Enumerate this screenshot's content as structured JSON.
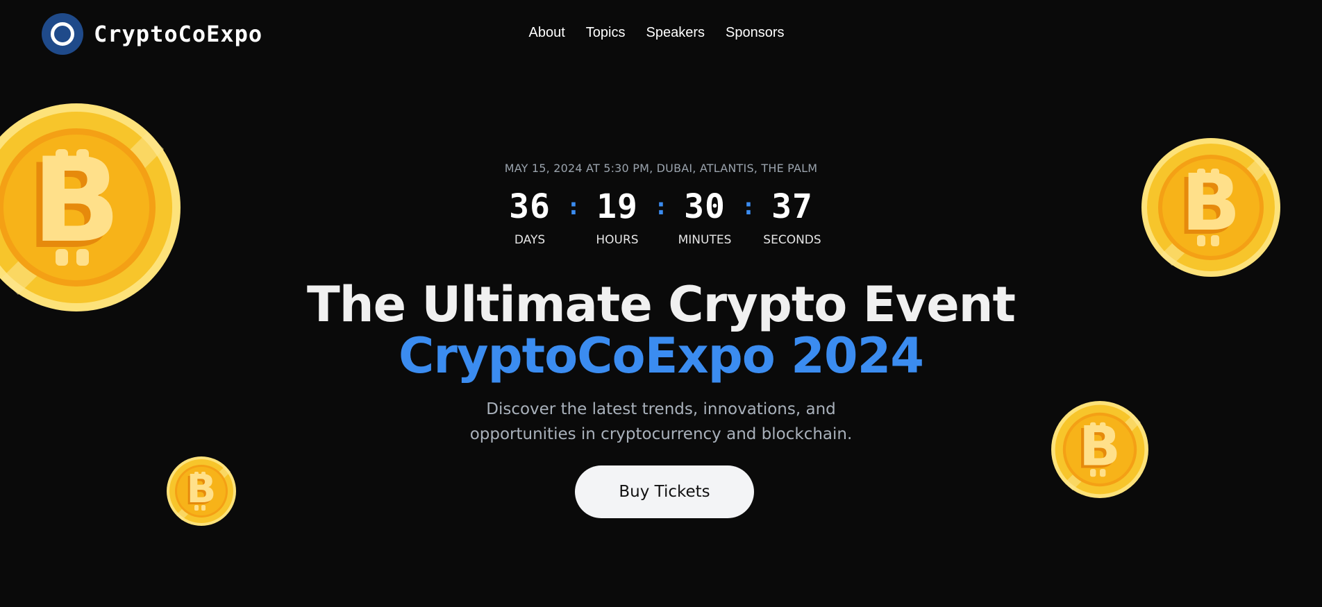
{
  "brand": {
    "name": "CryptoCoExpo"
  },
  "nav": {
    "items": [
      {
        "label": "About"
      },
      {
        "label": "Topics"
      },
      {
        "label": "Speakers"
      },
      {
        "label": "Sponsors"
      }
    ]
  },
  "event": {
    "meta": "MAY 15, 2024 AT 5:30 PM, DUBAI, ATLANTIS, THE PALM"
  },
  "countdown": {
    "separator": ":",
    "units": [
      {
        "value": "36",
        "label": "DAYS"
      },
      {
        "value": "19",
        "label": "HOURS"
      },
      {
        "value": "30",
        "label": "MINUTES"
      },
      {
        "value": "37",
        "label": "SECONDS"
      }
    ]
  },
  "hero": {
    "headline_line1": "The Ultimate Crypto Event",
    "headline_line2": "CryptoCoExpo 2024",
    "description": "Discover the latest trends, innovations, and opportunities in cryptocurrency and blockchain.",
    "cta_label": "Buy Tickets"
  },
  "decorations": {
    "coin_icon": "bitcoin-coin-icon"
  },
  "colors": {
    "background": "#0a0a0a",
    "accent": "#3b8cf0",
    "logo_mark": "#1f4a8a",
    "cta_background": "#f3f4f6",
    "coin_gold": "#f7c52b",
    "coin_orange": "#f4a015"
  }
}
